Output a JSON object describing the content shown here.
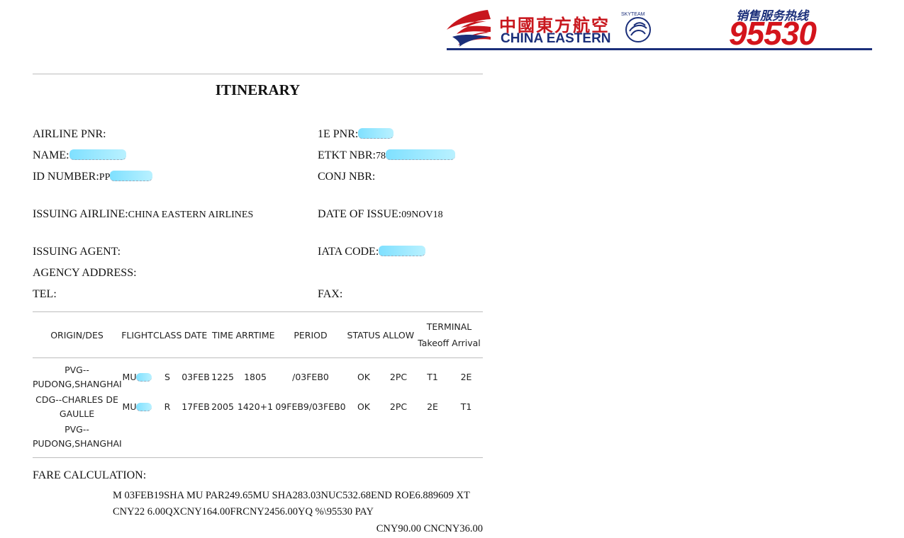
{
  "header": {
    "brand_cn": "中國東方航空",
    "brand_en": "CHINA EASTERN",
    "alliance": "SKYTEAM",
    "hotline_label": "销售服务热线",
    "hotline_number": "95530",
    "brand_red": "#c8161d",
    "brand_blue": "#1b2f7a"
  },
  "document": {
    "title": "ITINERARY",
    "fields": {
      "airline_pnr_label": "AIRLINE PNR:",
      "airline_pnr_value": "",
      "pnr_1e_label": "1E PNR:",
      "pnr_1e_value": "",
      "name_label": "NAME:",
      "name_value": "",
      "etkt_label": "ETKT NBR:",
      "etkt_value": "78",
      "id_label": "ID NUMBER:",
      "id_value": "PP",
      "conj_label": "CONJ NBR:",
      "conj_value": "",
      "issuing_airline_label": "ISSUING AIRLINE:",
      "issuing_airline_value": "CHINA EASTERN AIRLINES",
      "date_issue_label": "DATE OF ISSUE:",
      "date_issue_value": "09NOV18",
      "issuing_agent_label": "ISSUING AGENT:",
      "issuing_agent_value": "",
      "iata_label": "IATA CODE:",
      "iata_value": "",
      "agency_address_label": "AGENCY ADDRESS:",
      "agency_address_value": "",
      "tel_label": "TEL:",
      "tel_value": "",
      "fax_label": "FAX:",
      "fax_value": ""
    },
    "table": {
      "headers": {
        "origin": "ORIGIN/DES",
        "flight": "FLIGHT",
        "class": "CLASS",
        "date": "DATE",
        "time": "TIME",
        "arrtime": "ARRTIME",
        "period": "PERIOD",
        "status": "STATUS",
        "allow": "ALLOW",
        "terminal": "TERMINAL",
        "takeoff": "Takeoff",
        "arrival": "Arrival"
      },
      "rows": [
        {
          "origin": "PVG--PUDONG,SHANGHAI",
          "flight": "MU",
          "class": "S",
          "date": "03FEB",
          "time": "1225",
          "arrtime": "1805",
          "period": "/03FEB0",
          "status": "OK",
          "allow": "2PC",
          "takeoff": "T1",
          "arrival": "2E"
        },
        {
          "origin": "CDG--CHARLES DE GAULLE",
          "flight": "MU",
          "class": "R",
          "date": "17FEB",
          "time": "2005",
          "arrtime": "1420+1",
          "period": "09FEB9/03FEB0",
          "status": "OK",
          "allow": "2PC",
          "takeoff": "2E",
          "arrival": "T1"
        }
      ],
      "final_destination": "PVG--PUDONG,SHANGHAI"
    },
    "fare": {
      "label": "FARE CALCULATION:",
      "line1": "M 03FEB19SHA MU PAR249.65MU SHA283.03NUC532.68END ROE6.889609 XT",
      "line2": "CNY22 6.00QXCNY164.00FRCNY2456.00YQ %\\95530 PAY",
      "line3": "CNY90.00 CNCNY36.00"
    }
  }
}
